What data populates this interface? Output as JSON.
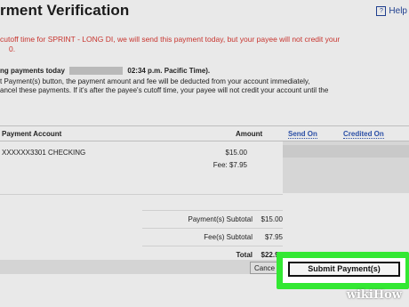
{
  "page": {
    "title": "rment Verification",
    "help_label": "Help",
    "help_icon": "question-mark-box-icon"
  },
  "notice": {
    "line1": "cutoff time for SPRINT - LONG DI, we will send this payment today, but your payee will not credit your",
    "line2": "0."
  },
  "payments_today": {
    "prefix": "ng payments today",
    "time": "02:34 p.m. Pacific Time)."
  },
  "paragraph": {
    "line1": "t Payment(s) button, the payment amount and fee will be deducted from your account immediately,",
    "line2": "ancel these payments. If it's after the payee's cutoff time, your payee will not credit your account until the"
  },
  "table": {
    "headers": {
      "account": "Payment Account",
      "amount": "Amount",
      "send_on": "Send On",
      "credited_on": "Credited On"
    },
    "row": {
      "account": "XXXXXX3301 CHECKING",
      "amount": "$15.00",
      "fee": "Fee: $7.95"
    }
  },
  "totals": {
    "payment_subtotal_label": "Payment(s) Subtotal",
    "payment_subtotal_value": "$15.00",
    "fee_subtotal_label": "Fee(s) Subtotal",
    "fee_subtotal_value": "$7.95",
    "total_label": "Total",
    "total_value": "$22.95"
  },
  "buttons": {
    "cancel": "Cance",
    "submit": "Submit Payment(s)"
  },
  "watermark": "wikiHow",
  "colors": {
    "notice_red": "#c8352f",
    "link_blue": "#2b4fa6",
    "highlight_green": "#33e833"
  }
}
